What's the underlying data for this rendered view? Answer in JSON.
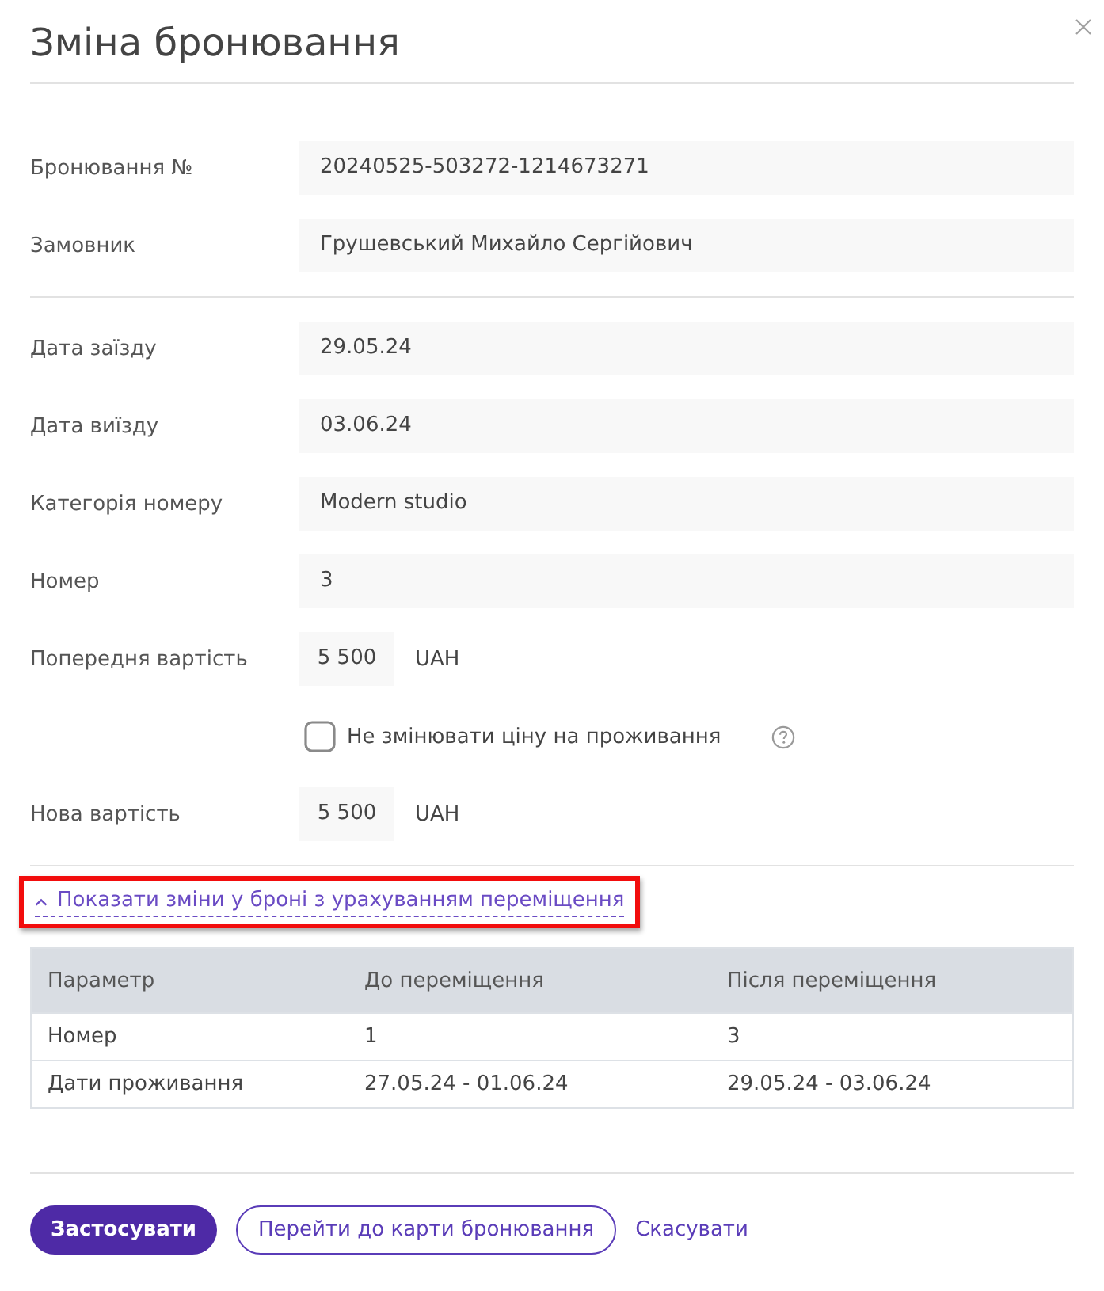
{
  "dialog": {
    "title": "Зміна бронювання"
  },
  "sections": [
    {
      "fields": [
        {
          "kind": "text",
          "label": "Бронювання №",
          "value": "20240525-503272-1214673271"
        },
        {
          "kind": "text",
          "label": "Замовник",
          "value": "Грушевський Михайло Сергійович"
        }
      ]
    },
    {
      "fields": [
        {
          "kind": "text",
          "label": "Дата заїзду",
          "value": "29.05.24"
        },
        {
          "kind": "text",
          "label": "Дата виїзду",
          "value": "03.06.24"
        },
        {
          "kind": "text",
          "label": "Категорія номеру",
          "value": "Modern studio"
        },
        {
          "kind": "text",
          "label": "Номер",
          "value": "3"
        },
        {
          "kind": "price",
          "label": "Попередня вартість",
          "value": "5 500",
          "unit": "UAH"
        },
        {
          "kind": "checkbox",
          "label": "Не змінювати ціну на проживання",
          "checked": false
        },
        {
          "kind": "price",
          "label": "Нова вартість",
          "value": "5 500",
          "unit": "UAH"
        }
      ]
    }
  ],
  "changes_toggle": {
    "label": "Показати зміни у броні з урахуванням переміщення",
    "expanded": true,
    "highlighted": true
  },
  "changes_table": {
    "columns": [
      "Параметр",
      "До переміщення",
      "Після переміщення"
    ],
    "rows": [
      [
        "Номер",
        "1",
        "3"
      ],
      [
        "Дати проживання",
        "27.05.24 - 01.06.24",
        "29.05.24 - 03.06.24"
      ]
    ]
  },
  "buttons": [
    {
      "kind": "primary",
      "label": "Застосувати"
    },
    {
      "kind": "outline",
      "label": "Перейти до карти бронювання"
    },
    {
      "kind": "link",
      "label": "Скасувати"
    }
  ]
}
